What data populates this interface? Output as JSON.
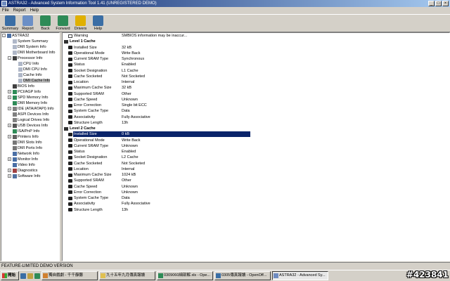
{
  "window": {
    "title": "ASTRA32 - Advanced System Information Tool 1.41 (UNREGISTERED DEMO)",
    "min": "_",
    "max": "□",
    "close": "×"
  },
  "menu": [
    "File",
    "Report",
    "Help"
  ],
  "toolbar": [
    {
      "label": "Summary",
      "icon": "summary-icon",
      "color": "#3a6ea5"
    },
    {
      "label": "Report",
      "icon": "report-icon",
      "color": "#6b8fc6"
    },
    {
      "label": "Back",
      "icon": "back-arrow-icon",
      "color": "#2e8b57"
    },
    {
      "label": "Forward",
      "icon": "forward-arrow-icon",
      "color": "#2e8b57"
    },
    {
      "label": "Drivers",
      "icon": "drivers-warning-icon",
      "color": "#e0b000"
    },
    {
      "label": "Help",
      "icon": "help-icon",
      "color": "#3a6ea5"
    }
  ],
  "tree": [
    {
      "label": "ASTRA32",
      "level": 0,
      "exp": "-",
      "icon": "computer-icon"
    },
    {
      "label": "System Summary",
      "level": 1,
      "icon": "doc-icon"
    },
    {
      "label": "DMI System Info",
      "level": 1,
      "icon": "doc-icon"
    },
    {
      "label": "DMI Motherboard Info",
      "level": 1,
      "icon": "doc-icon"
    },
    {
      "label": "Processor Info",
      "level": 1,
      "exp": "-",
      "icon": "chip-icon"
    },
    {
      "label": "CPU Info",
      "level": 2,
      "icon": "doc-icon"
    },
    {
      "label": "DMI CPU Info",
      "level": 2,
      "icon": "doc-icon"
    },
    {
      "label": "Cache Info",
      "level": 2,
      "icon": "doc-icon"
    },
    {
      "label": "DMI Cache Info",
      "level": 2,
      "icon": "doc-icon",
      "selected": true
    },
    {
      "label": "BIOS Info",
      "level": 1,
      "icon": "chip-icon"
    },
    {
      "label": "PCI/AGP Info",
      "level": 1,
      "exp": "+",
      "icon": "card-icon"
    },
    {
      "label": "SPD Memory Info",
      "level": 1,
      "exp": "+",
      "icon": "memory-icon"
    },
    {
      "label": "DMI Memory Info",
      "level": 1,
      "icon": "memory-icon"
    },
    {
      "label": "IDE (ATA/ATAPI) Info",
      "level": 1,
      "exp": "+",
      "icon": "drive-icon"
    },
    {
      "label": "ASPI Devices Info",
      "level": 1,
      "icon": "drive-icon"
    },
    {
      "label": "Logical Drives Info",
      "level": 1,
      "icon": "drive-icon"
    },
    {
      "label": "USB Devices Info",
      "level": 1,
      "exp": "+",
      "icon": "usb-icon"
    },
    {
      "label": "ISA/PnP Info",
      "level": 1,
      "icon": "card-icon"
    },
    {
      "label": "Printers Info",
      "level": 1,
      "exp": "+",
      "icon": "printer-icon"
    },
    {
      "label": "DMI Slots Info",
      "level": 1,
      "icon": "slot-icon"
    },
    {
      "label": "DMI Ports Info",
      "level": 1,
      "icon": "port-icon"
    },
    {
      "label": "Network Info",
      "level": 1,
      "icon": "network-icon"
    },
    {
      "label": "Monitor Info",
      "level": 1,
      "exp": "+",
      "icon": "monitor-icon"
    },
    {
      "label": "Video Info",
      "level": 1,
      "icon": "video-icon"
    },
    {
      "label": "Diagnostics",
      "level": 1,
      "exp": "+",
      "icon": "diagnostics-icon"
    },
    {
      "label": "Software Info",
      "level": 1,
      "exp": "+",
      "icon": "software-icon"
    }
  ],
  "details": [
    {
      "type": "warn",
      "k": "Warning",
      "v": "SMBIOS information may be inaccur..."
    },
    {
      "type": "head",
      "k": "Level 1 Cache"
    },
    {
      "k": "Installed Size",
      "v": "32 kB"
    },
    {
      "k": "Operational Mode",
      "v": "Write Back"
    },
    {
      "k": "Current SRAM Type",
      "v": "Synchronous"
    },
    {
      "k": "Status",
      "v": "Enabled"
    },
    {
      "k": "Socket Designation",
      "v": "L1 Cache"
    },
    {
      "k": "Cache Socketed",
      "v": "Not Socketed"
    },
    {
      "k": "Location",
      "v": "Internal"
    },
    {
      "k": "Maximum Cache Size",
      "v": "32 kB"
    },
    {
      "k": "Supported SRAM",
      "v": "Other"
    },
    {
      "k": "Cache Speed",
      "v": "Unknown"
    },
    {
      "k": "Error Correction",
      "v": "Single bit ECC"
    },
    {
      "k": "System Cache Type",
      "v": "Data"
    },
    {
      "k": "Associativity",
      "v": "Fully Associative"
    },
    {
      "k": "Structure Length",
      "v": "13h"
    },
    {
      "type": "head",
      "k": "Level 2 Cache"
    },
    {
      "k": "Installed Size",
      "v": "0 kB",
      "selected": true
    },
    {
      "k": "Operational Mode",
      "v": "Write Back"
    },
    {
      "k": "Current SRAM Type",
      "v": "Unknown"
    },
    {
      "k": "Status",
      "v": "Enabled"
    },
    {
      "k": "Socket Designation",
      "v": "L2 Cache"
    },
    {
      "k": "Cache Socketed",
      "v": "Not Socketed"
    },
    {
      "k": "Location",
      "v": "Internal"
    },
    {
      "k": "Maximum Cache Size",
      "v": "1024 kB"
    },
    {
      "k": "Supported SRAM",
      "v": "Other"
    },
    {
      "k": "Cache Speed",
      "v": "Unknown"
    },
    {
      "k": "Error Correction",
      "v": "Unknown"
    },
    {
      "k": "System Cache Type",
      "v": "Data"
    },
    {
      "k": "Associativity",
      "v": "Fully Associative"
    },
    {
      "k": "Structure Length",
      "v": "13h"
    }
  ],
  "status": "FEATURE-LIMITED DEMO VERSION",
  "taskbar": {
    "start": "開始",
    "tasks": [
      {
        "label": "獨自戲劇 - 千千靜聽",
        "color": "#d08030"
      },
      {
        "label": "九十五年九月傳真報讀",
        "color": "#e0c050"
      },
      {
        "label": "0309060細部解.xls - Ope...",
        "color": "#2e8b57"
      },
      {
        "label": "0305傳真報讀 - OpenOff...",
        "color": "#3a6ea5"
      },
      {
        "label": "ASTRA32 - Advanced Sy...",
        "color": "#6e8bc0",
        "active": true
      }
    ],
    "watermark": "#423841"
  }
}
